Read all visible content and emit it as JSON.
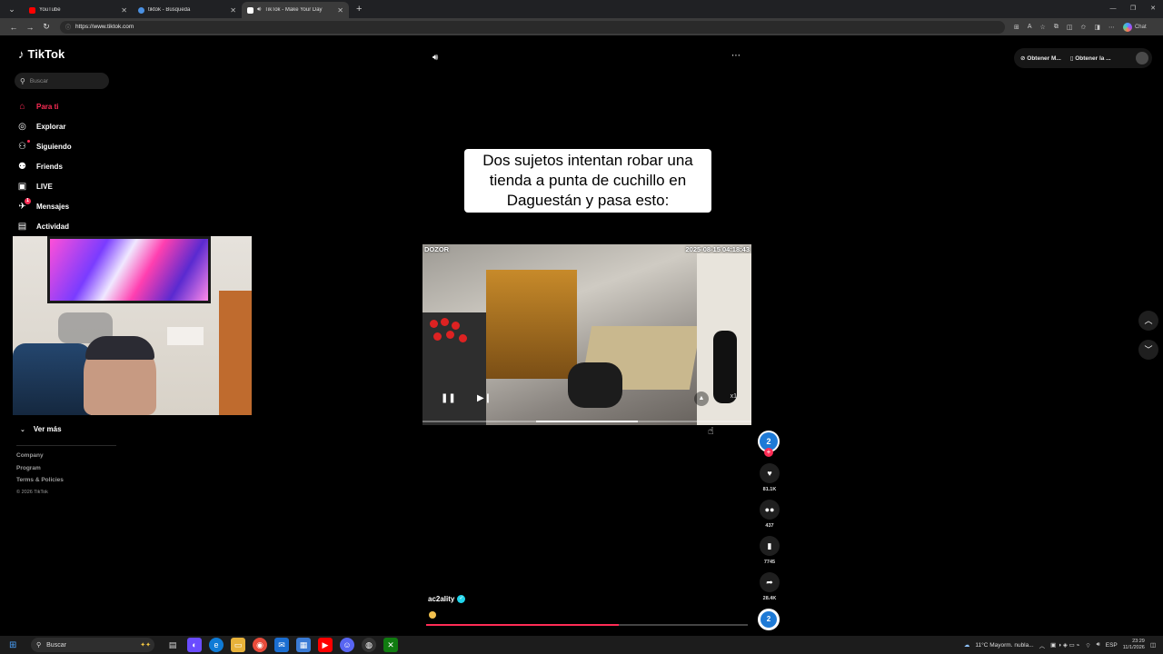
{
  "browser": {
    "tabs": [
      {
        "title": "YouTube",
        "color": "#ff0000"
      },
      {
        "title": "tiktok - Búsqueda",
        "color": "#4a90e2"
      },
      {
        "title": "TikTok - Make Your Day",
        "color": "#ffffff"
      }
    ],
    "url": "https://www.tiktok.com",
    "copilot_label": "Chat"
  },
  "sidebar": {
    "brand": "TikTok",
    "search_placeholder": "Buscar",
    "nav": [
      {
        "label": "Para ti",
        "icon": "home-icon",
        "active": true
      },
      {
        "label": "Explorar",
        "icon": "compass-icon"
      },
      {
        "label": "Siguiendo",
        "icon": "user-follow-icon"
      },
      {
        "label": "Friends",
        "icon": "friends-icon"
      },
      {
        "label": "LIVE",
        "icon": "live-icon"
      },
      {
        "label": "Mensajes",
        "icon": "messages-icon",
        "badge": "1"
      },
      {
        "label": "Actividad",
        "icon": "activity-icon"
      }
    ],
    "ver_mas": "Ver más",
    "footer": {
      "company": "Company",
      "program": "Program",
      "terms": "Terms & Policies",
      "copyright": "© 2026 TikTok"
    }
  },
  "header": {
    "pill_1": "Obtener M...",
    "pill_2": "Obtener la ..."
  },
  "video": {
    "caption_line1": "Dos sujetos intentan robar una",
    "caption_line2": "tienda a punta de cuchillo en",
    "caption_line3": "Daguestán y pasa esto:",
    "cam_label": "DOZOR",
    "timestamp": "2025-08-15 04:18:43",
    "speed": "x1",
    "seek_position": 0.35,
    "seek_thumb_fraction": 0.31
  },
  "actions": {
    "author_initial": "2",
    "likes": "81.1K",
    "comments": "437",
    "saves": "7745",
    "shares": "28.4K"
  },
  "post": {
    "username": "ac2ality",
    "progress": 0.6
  },
  "taskbar": {
    "search_placeholder": "Buscar",
    "weather": "11°C  Mayorm. nubla...",
    "lang": "ESP",
    "time": "23:29",
    "date": "11/1/2026"
  },
  "colors": {
    "accent": "#fe2c55",
    "verified": "#20d5ec",
    "background": "#000000"
  }
}
